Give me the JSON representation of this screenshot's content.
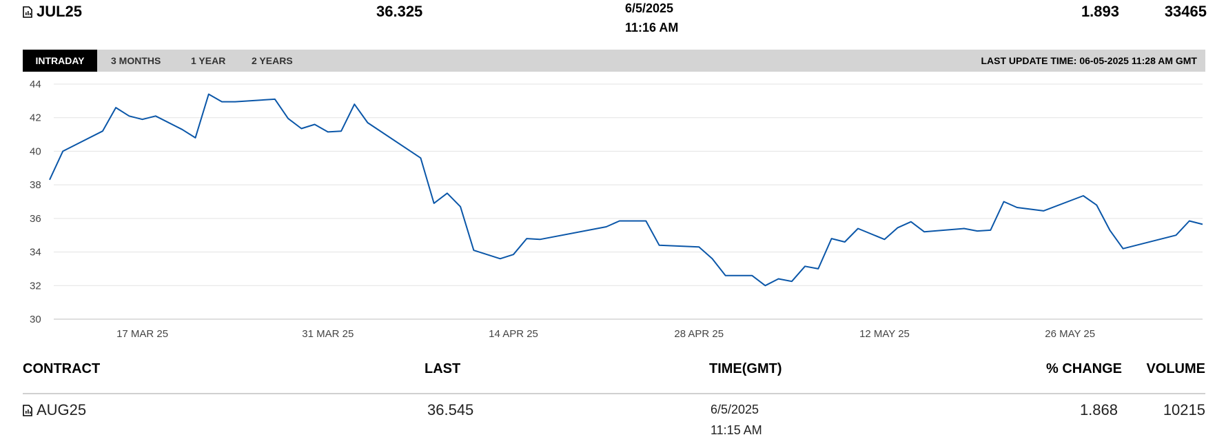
{
  "quote": {
    "contract": "JUL25",
    "last": "36.325",
    "date": "6/5/2025",
    "time": "11:16 AM",
    "pct_change": "1.893",
    "volume": "33465"
  },
  "tabs": [
    {
      "label": "INTRADAY",
      "active": true
    },
    {
      "label": "3 MONTHS",
      "active": false
    },
    {
      "label": "1 YEAR",
      "active": false
    },
    {
      "label": "2 YEARS",
      "active": false
    }
  ],
  "last_update": "LAST UPDATE TIME: 06-05-2025 11:28 AM GMT",
  "table": {
    "headers": {
      "contract": "CONTRACT",
      "last": "LAST",
      "time": "TIME(GMT)",
      "pct_change": "% CHANGE",
      "volume": "VOLUME"
    },
    "rows": [
      {
        "contract": "AUG25",
        "last": "36.545",
        "date": "6/5/2025",
        "time": "11:15 AM",
        "pct_change": "1.868",
        "volume": "10215"
      }
    ]
  },
  "colors": {
    "line": "#0a56a8",
    "grid": "#e3e3e3",
    "tab_bar": "#d4d4d4",
    "tab_active": "#000000"
  },
  "chart_data": {
    "type": "line",
    "title": "",
    "xlabel": "",
    "ylabel": "",
    "ylim": [
      30,
      44
    ],
    "yticks": [
      30,
      32,
      34,
      36,
      38,
      40,
      42,
      44
    ],
    "xlim": [
      "2025-03-10",
      "2025-06-05"
    ],
    "xticks": [
      {
        "label": "17 MAR 25",
        "date": "2025-03-17"
      },
      {
        "label": "31 MAR 25",
        "date": "2025-03-31"
      },
      {
        "label": "14 APR 25",
        "date": "2025-04-14"
      },
      {
        "label": "28 APR 25",
        "date": "2025-04-28"
      },
      {
        "label": "12 MAY 25",
        "date": "2025-05-12"
      },
      {
        "label": "26 MAY 25",
        "date": "2025-05-26"
      }
    ],
    "grid": true,
    "series": [
      {
        "x": [
          "2025-03-10",
          "2025-03-11",
          "2025-03-14",
          "2025-03-15",
          "2025-03-16",
          "2025-03-17",
          "2025-03-18",
          "2025-03-20",
          "2025-03-21",
          "2025-03-22",
          "2025-03-23",
          "2025-03-24",
          "2025-03-27",
          "2025-03-28",
          "2025-03-29",
          "2025-03-30",
          "2025-03-31",
          "2025-04-01",
          "2025-04-02",
          "2025-04-03",
          "2025-04-07",
          "2025-04-08",
          "2025-04-09",
          "2025-04-10",
          "2025-04-11",
          "2025-04-13",
          "2025-04-14",
          "2025-04-15",
          "2025-04-16",
          "2025-04-21",
          "2025-04-22",
          "2025-04-23",
          "2025-04-24",
          "2025-04-25",
          "2025-04-28",
          "2025-04-29",
          "2025-04-30",
          "2025-05-01",
          "2025-05-02",
          "2025-05-03",
          "2025-05-04",
          "2025-05-05",
          "2025-05-06",
          "2025-05-07",
          "2025-05-08",
          "2025-05-09",
          "2025-05-10",
          "2025-05-12",
          "2025-05-13",
          "2025-05-14",
          "2025-05-15",
          "2025-05-18",
          "2025-05-19",
          "2025-05-20",
          "2025-05-21",
          "2025-05-22",
          "2025-05-24",
          "2025-05-27",
          "2025-05-28",
          "2025-05-29",
          "2025-05-30",
          "2025-06-03",
          "2025-06-04",
          "2025-06-05"
        ],
        "y": [
          38.3,
          40.0,
          41.2,
          42.6,
          42.1,
          41.9,
          42.1,
          41.3,
          40.8,
          43.4,
          42.95,
          42.95,
          43.1,
          41.95,
          41.35,
          41.6,
          41.15,
          41.2,
          42.8,
          41.7,
          39.6,
          36.9,
          37.5,
          36.7,
          34.1,
          33.6,
          33.85,
          34.8,
          34.75,
          35.5,
          35.85,
          35.85,
          35.85,
          34.4,
          34.3,
          33.6,
          32.6,
          32.6,
          32.6,
          32.0,
          32.4,
          32.25,
          33.15,
          33.0,
          34.8,
          34.6,
          35.4,
          34.75,
          35.45,
          35.8,
          35.2,
          35.4,
          35.25,
          35.3,
          37.0,
          36.65,
          36.45,
          37.35,
          36.8,
          35.3,
          34.2,
          35.0,
          35.85,
          35.65
        ]
      }
    ]
  }
}
